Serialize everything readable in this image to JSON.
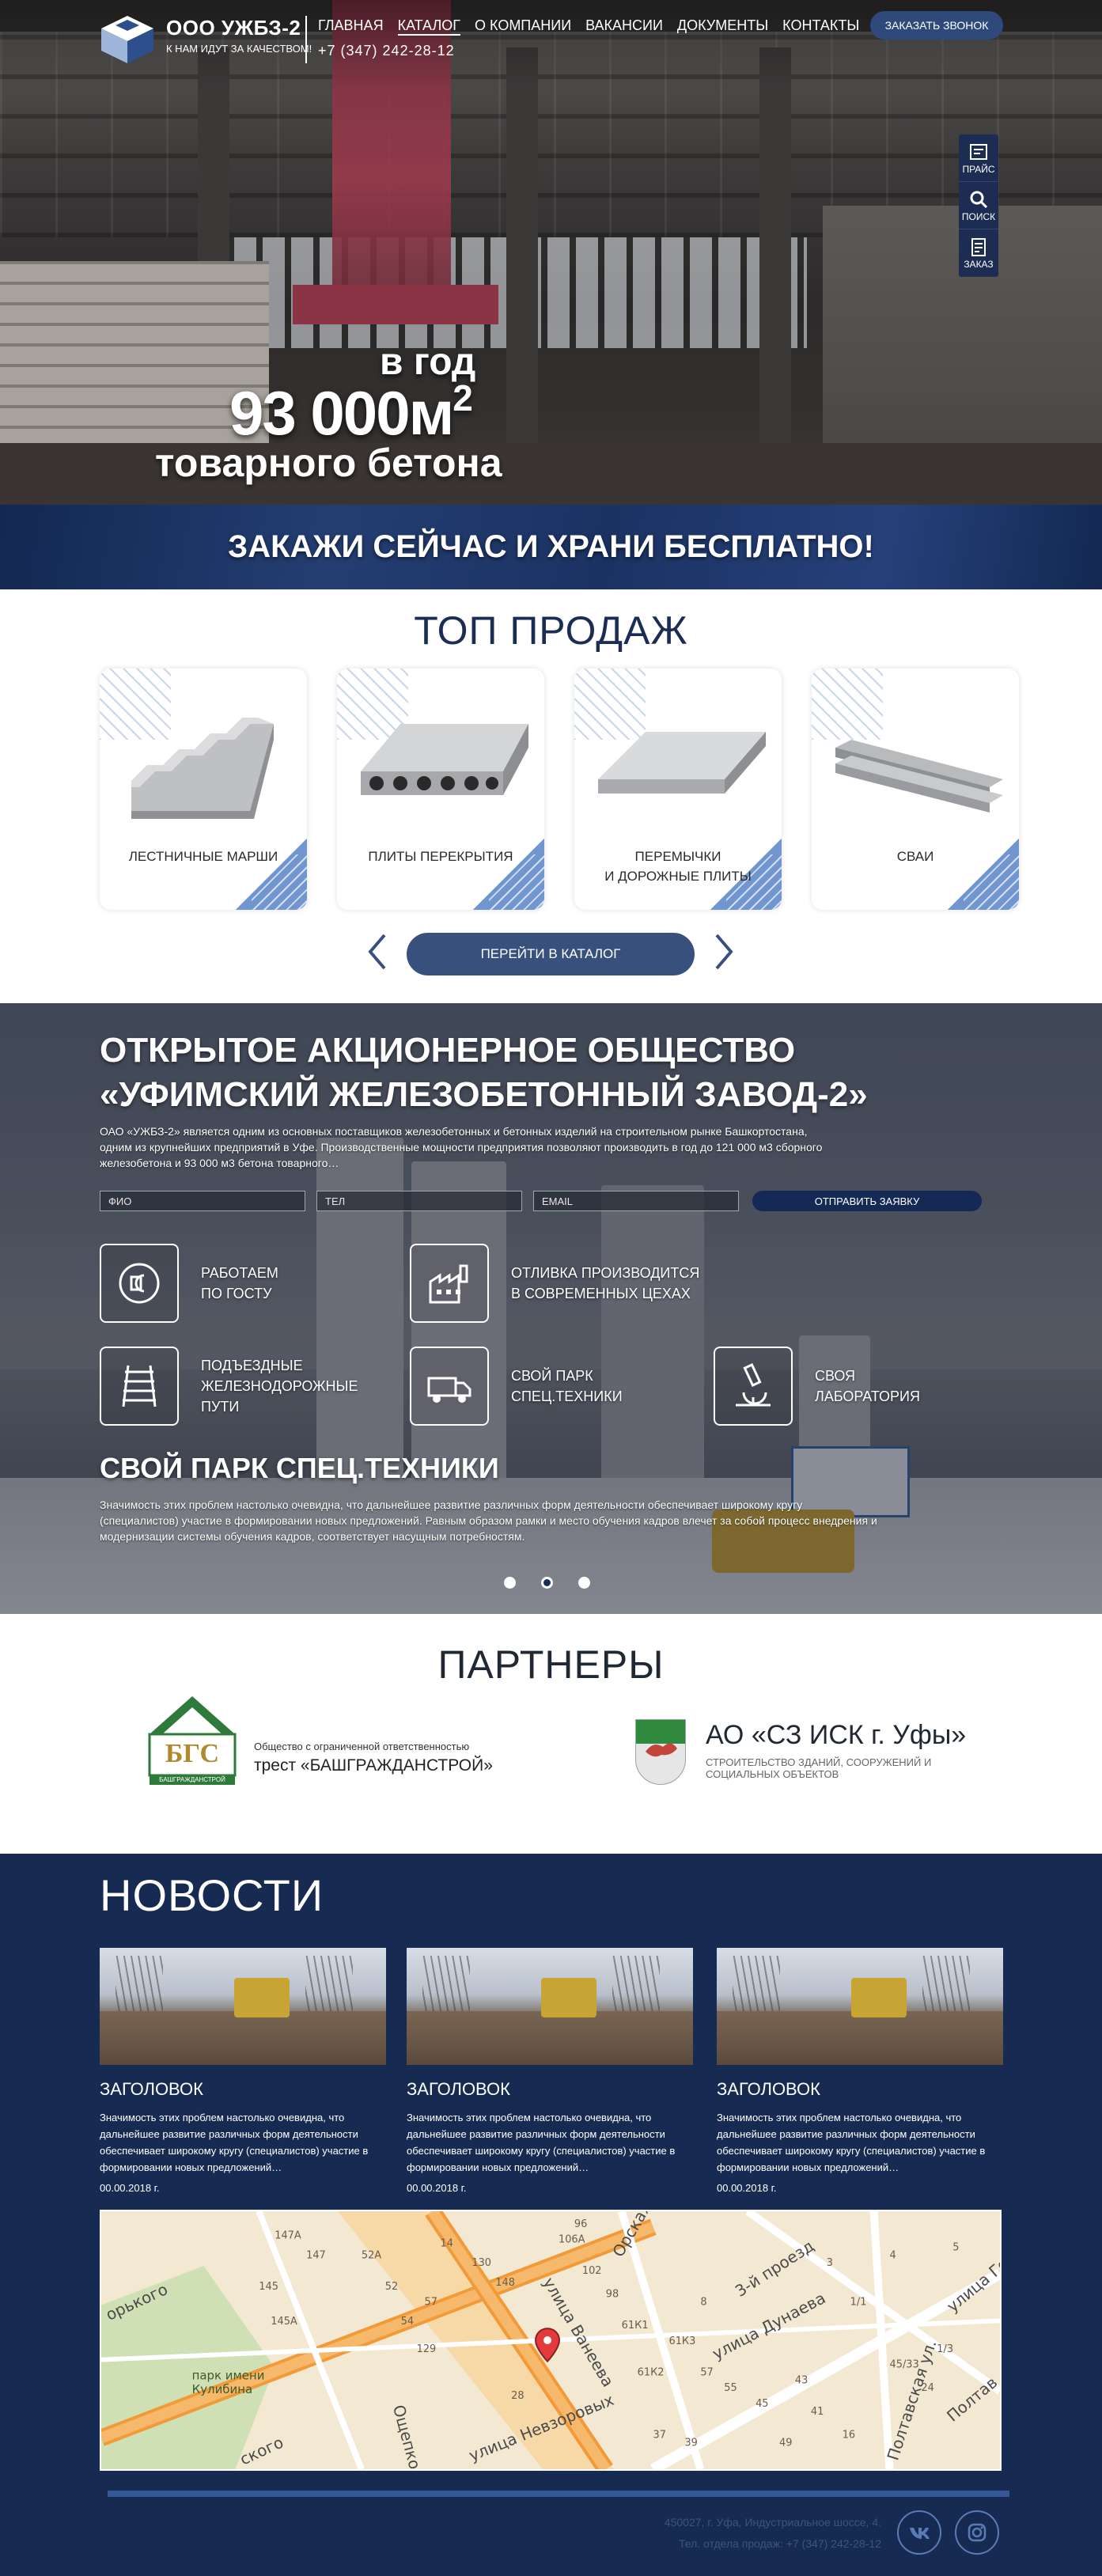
{
  "header": {
    "brand_name": "ООО УЖБЗ-2",
    "brand_slogan": "К НАМ ИДУТ ЗА КАЧЕСТВОМ!",
    "phone": "+7 (347) 242-28-12",
    "nav": [
      {
        "label": "ГЛАВНАЯ",
        "active": false
      },
      {
        "label": "КАТАЛОГ",
        "active": true
      },
      {
        "label": "О КОМПАНИИ",
        "active": false
      },
      {
        "label": "ВАКАНСИИ",
        "active": false
      },
      {
        "label": "ДОКУМЕНТЫ",
        "active": false
      },
      {
        "label": "КОНТАКТЫ",
        "active": false
      }
    ],
    "call_button": "ЗАКАЗАТЬ ЗВОНОК"
  },
  "side_tools": [
    {
      "label": "ПРАЙС",
      "icon": "price-icon"
    },
    {
      "label": "ПОИСК",
      "icon": "search-icon"
    },
    {
      "label": "ЗАКАЗ",
      "icon": "order-icon"
    }
  ],
  "hero": {
    "line1": "в год",
    "line2": "93 000м",
    "line2_sup": "2",
    "line3": "товарного бетона",
    "promo": "ЗАКАЖИ СЕЙЧАС И ХРАНИ БЕСПЛАТНО!"
  },
  "top_sales": {
    "title": "ТОП ПРОДАЖ",
    "products": [
      {
        "label": "ЛЕСТНИЧНЫЕ МАРШИ",
        "icon": "stairs-icon"
      },
      {
        "label": "ПЛИТЫ ПЕРЕКРЫТИЯ",
        "icon": "hollow-slab-icon"
      },
      {
        "label": "ПЕРЕМЫЧКИ\nИ ДОРОЖНЫЕ ПЛИТЫ",
        "icon": "road-slab-icon"
      },
      {
        "label": "СВАИ",
        "icon": "piles-icon"
      }
    ],
    "catalog_button": "ПЕРЕЙТИ В КАТАЛОГ"
  },
  "company": {
    "title": "ОТКРЫТОЕ АКЦИОНЕРНОЕ ОБЩЕСТВО\n«УФИМСКИЙ ЖЕЛЕЗОБЕТОННЫЙ ЗАВОД-2»",
    "text": "ОАО «УЖБЗ-2» является одним из основных поставщиков железобетонных и бетонных изделий на строительном рынке Башкортостана, одним из крупнейших предприятий в Уфе. Производственные мощности предприятия  позволяют производить в  год  до 121 000 м3 сборного железобетона и 93 000 м3 бетона товарного…",
    "form": {
      "name_placeholder": "ФИО",
      "phone_placeholder": "ТЕЛ",
      "email_placeholder": "EMAIL",
      "submit": "ОТПРАВИТЬ ЗАЯВКУ"
    },
    "features": [
      {
        "label": "РАБОТАЕМ\nПО ГОСТУ",
        "icon": "gost-icon"
      },
      {
        "label": "ОТЛИВКА ПРОИЗВОДИТСЯ\nВ СОВРЕМЕННЫХ ЦЕХАХ",
        "icon": "factory-icon"
      },
      {
        "label": "ПОДЪЕЗДНЫЕ\nЖЕЛЕЗНОДОРОЖНЫЕ\nПУТИ",
        "icon": "railway-icon"
      },
      {
        "label": "СВОЙ ПАРК\nСПЕЦ.ТЕХНИКИ",
        "icon": "truck-icon"
      },
      {
        "label": "СВОЯ\nЛАБОРАТОРИЯ",
        "icon": "microscope-icon"
      }
    ],
    "slide_title": "СВОЙ ПАРК СПЕЦ.ТЕХНИКИ",
    "slide_text": "Значимость этих проблем настолько очевидна, что дальнейшее развитие различных форм деятельности обеспечивает широкому кругу (специалистов) участие в формировании новых предложений. Равным образом рамки и место обучения кадров влечет за собой процесс внедрения и модернизации системы обучения кадров, соответствует насущным потребностям.",
    "slider_dots": 3,
    "slider_active": 2
  },
  "partners": {
    "title": "ПАРТНЕРЫ",
    "p1_logo_text": "БГС",
    "p1_logo_caption": "БАШГРАЖДАНСТРОЙ",
    "p1_sub": "Общество с ограниченной ответственностью",
    "p1_name": "трест «БАШГРАЖДАНСТРОЙ»",
    "p2_name": "АО «СЗ ИСК г. Уфы»",
    "p2_sub": "СТРОИТЕЛЬСТВО ЗДАНИЙ, СООРУЖЕНИЙ И СОЦИАЛЬНЫХ ОБЪЕКТОВ"
  },
  "news": {
    "title": "НОВОСТИ",
    "items": [
      {
        "title": "ЗАГОЛОВОК",
        "text": "Значимость этих проблем настолько очевидна, что дальнейшее развитие различных форм деятельности обеспечивает широкому кругу (специалистов) участие в формировании новых предложений…",
        "date": "00.00.2018 г."
      },
      {
        "title": "ЗАГОЛОВОК",
        "text": "Значимость этих проблем настолько очевидна, что дальнейшее развитие различных форм деятельности обеспечивает широкому кругу (специалистов) участие в формировании новых предложений…",
        "date": "00.00.2018 г."
      },
      {
        "title": "ЗАГОЛОВОК",
        "text": "Значимость этих проблем настолько очевидна, что дальнейшее развитие различных форм деятельности обеспечивает широкому кругу (специалистов) участие в формировании новых предложений…",
        "date": "00.00.2018 г."
      }
    ]
  },
  "map": {
    "labels": {
      "street_vaneeva": "улица Ванеева",
      "street_nevzorovyh": "улица Невзоровых",
      "street_dunaeva": "улица Дунаева",
      "third_passage": "3-й проезд",
      "park": "парк имени\nКулибина",
      "gorkogo": "орького",
      "oshchepkova": "Ощепкова",
      "poltavskaya": "Полтавская ул.",
      "orskaya": "Орская улица",
      "skogo": "ского",
      "gen": "улица Ген",
      "poltav": "Полтав"
    },
    "houses": [
      "147А",
      "147",
      "145",
      "145А",
      "52А",
      "52",
      "54",
      "57",
      "130",
      "148",
      "14",
      "129",
      "106А",
      "102",
      "98",
      "96",
      "61К1",
      "61К3",
      "61К2",
      "57",
      "55",
      "45",
      "43",
      "41",
      "16",
      "49",
      "45/33",
      "24",
      "1/3",
      "1/1",
      "3",
      "4",
      "5",
      "8",
      "37",
      "39",
      "28"
    ]
  },
  "footer": {
    "address": "450027, г. Уфа, Индустриальное шоссе, 4.",
    "sales_phone": "Тел. отдела продаж: +7  (347) 242-28-12",
    "social": [
      "vk-icon",
      "instagram-icon"
    ]
  },
  "colors": {
    "navy": "#172b52",
    "accent": "#37507c",
    "title": "#1b2c55",
    "footer_text": "#3b557f"
  }
}
